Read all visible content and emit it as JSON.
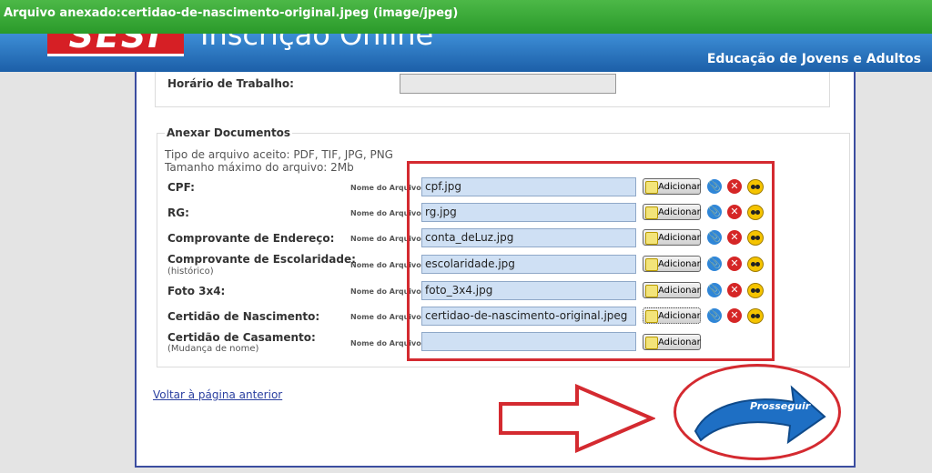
{
  "notice": {
    "text": "Arquivo anexado:certidao-de-nascimento-original.jpeg (image/jpeg)"
  },
  "header": {
    "logo": "SESI",
    "title": "Inscrição Online",
    "subtitle": "Educação de Jovens e Adultos"
  },
  "form": {
    "horario_label": "Horário de Trabalho:",
    "anexar_legend": "Anexar Documentos",
    "tipo_text": "Tipo de arquivo aceito: PDF, TIF, JPG, PNG",
    "tamanho_text": "Tamanho máximo do arquivo: 2Mb",
    "nome_label": "Nome do Arquivo",
    "add_label": "Adicionar",
    "documents": [
      {
        "label": "CPF:",
        "sub": "",
        "file": "cpf.jpg"
      },
      {
        "label": "RG:",
        "sub": "",
        "file": "rg.jpg"
      },
      {
        "label": "Comprovante de Endereço:",
        "sub": "",
        "file": "conta_deLuz.jpg"
      },
      {
        "label": "Comprovante de Escolaridade:",
        "sub": "(histórico)",
        "file": "escolaridade.jpg"
      },
      {
        "label": "Foto 3x4:",
        "sub": "",
        "file": "foto_3x4.jpg"
      },
      {
        "label": "Certidão de Nascimento:",
        "sub": "",
        "file": "certidao-de-nascimento-original.jpeg"
      },
      {
        "label": "Certidão de Casamento:",
        "sub": "(Mudança de nome)",
        "file": ""
      }
    ]
  },
  "nav": {
    "back_label": "Voltar à página anterior",
    "next_label": "Prosseguir"
  },
  "icons": {
    "attach": "paperclip-icon",
    "delete": "delete-icon",
    "view": "view-icon"
  },
  "colors": {
    "notice_green": "#3aa93a",
    "header_blue": "#2a74c4",
    "highlight_red": "#d42a30"
  }
}
